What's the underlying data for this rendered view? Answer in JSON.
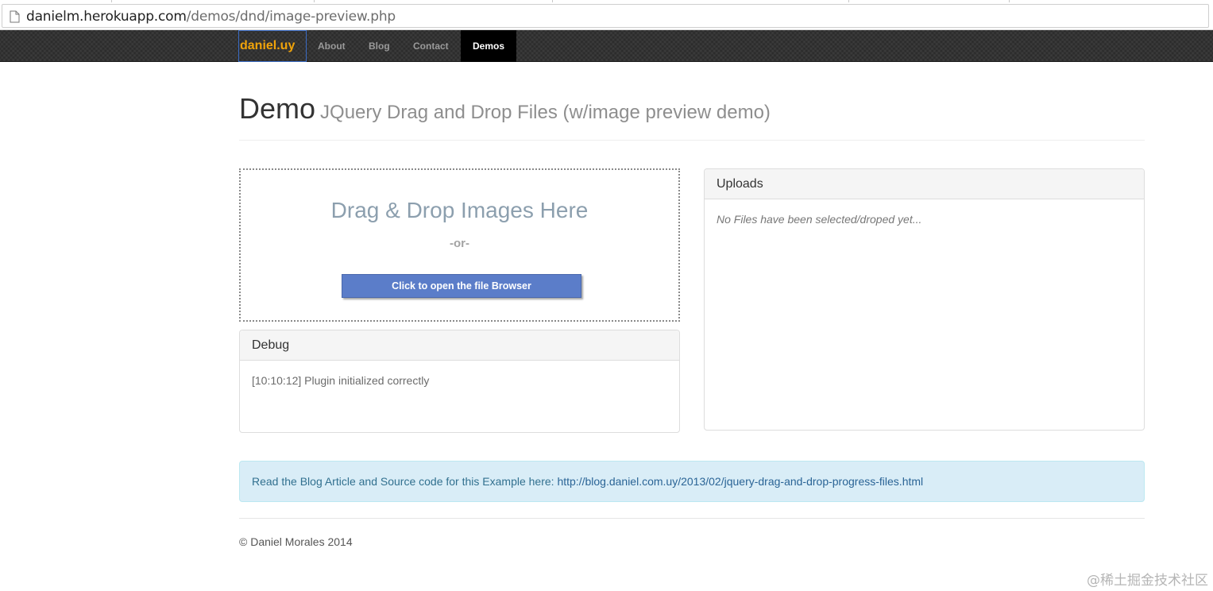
{
  "browser": {
    "url_host": "danielm.herokuapp.com",
    "url_path": "/demos/dnd/image-preview.php"
  },
  "navbar": {
    "brand": "daniel.uy",
    "links": [
      {
        "label": "About"
      },
      {
        "label": "Blog"
      },
      {
        "label": "Contact"
      },
      {
        "label": "Demos",
        "active": true
      }
    ],
    "brand_color": "#f0a30a"
  },
  "header": {
    "title": "Demo",
    "subtitle": "JQuery Drag and Drop Files (w/image preview demo)"
  },
  "dropzone": {
    "title": "Drag & Drop Images Here",
    "or_text": "-or-",
    "button_label": "Click to open the file Browser",
    "button_color": "#5b7dc9"
  },
  "debug": {
    "heading": "Debug",
    "log": "[10:10:12] Plugin initialized correctly"
  },
  "uploads": {
    "heading": "Uploads",
    "empty_text": "No Files have been selected/droped yet..."
  },
  "alert": {
    "text": "Read the Blog Article and Source code for this Example here: ",
    "link": "http://blog.daniel.com.uy/2013/02/jquery-drag-and-drop-progress-files.html"
  },
  "footer": {
    "copyright": "© Daniel Morales 2014"
  },
  "watermark": "@稀土掘金技术社区"
}
